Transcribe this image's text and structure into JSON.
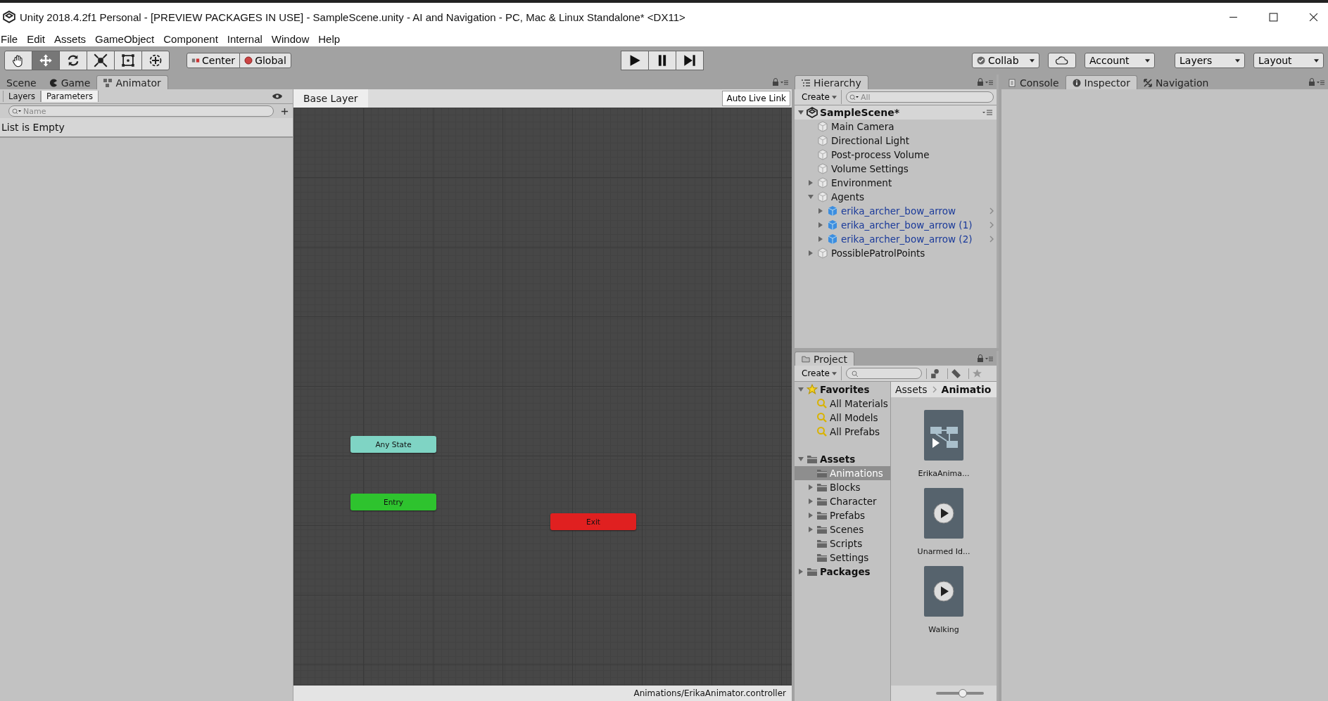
{
  "window": {
    "title": "Unity 2018.4.2f1 Personal - [PREVIEW PACKAGES IN USE] - SampleScene.unity - AI and Navigation - PC, Mac & Linux Standalone* <DX11>"
  },
  "menu": [
    "File",
    "Edit",
    "Assets",
    "GameObject",
    "Component",
    "Internal",
    "Window",
    "Help"
  ],
  "toolbar": {
    "tools": [
      {
        "kind": "hand",
        "selected": false
      },
      {
        "kind": "move",
        "selected": true
      },
      {
        "kind": "rotate",
        "selected": false
      },
      {
        "kind": "scale",
        "selected": false
      },
      {
        "kind": "rect",
        "selected": false
      },
      {
        "kind": "transform",
        "selected": false
      }
    ],
    "pivot": [
      {
        "label": "Center",
        "kind": "center"
      },
      {
        "label": "Global",
        "kind": "global"
      }
    ],
    "playback": [
      {
        "kind": "play"
      },
      {
        "kind": "pause"
      },
      {
        "kind": "step"
      }
    ],
    "right": [
      {
        "kind": "collab",
        "label": "Collab"
      },
      {
        "kind": "cloud"
      },
      {
        "kind": "dropdown",
        "label": "Account"
      },
      {
        "kind": "dropdown",
        "label": "Layers"
      },
      {
        "kind": "dropdown",
        "label": "Layout"
      }
    ]
  },
  "left_tabs": [
    {
      "label": "Scene",
      "kind": "scene",
      "selected": false
    },
    {
      "label": "Game",
      "kind": "game",
      "selected": false
    },
    {
      "label": "Animator",
      "kind": "animator",
      "selected": true
    }
  ],
  "animator": {
    "sub_tabs": [
      {
        "label": "Layers",
        "selected": false
      },
      {
        "label": "Parameters",
        "selected": true
      }
    ],
    "search": {
      "placeholder": "Name"
    },
    "empty_message": "List is Empty",
    "breadcrumb": "Base Layer",
    "auto_live_link": "Auto Live Link",
    "nodes": [
      {
        "label": "Any State",
        "kind": "any"
      },
      {
        "label": "Entry",
        "kind": "entry"
      },
      {
        "label": "Exit",
        "kind": "exit"
      }
    ],
    "status": "Animations/ErikaAnimator.controller"
  },
  "hierarchy": {
    "tab": "Hierarchy",
    "create": "Create",
    "search": {
      "placeholder": "All"
    },
    "scene": "SampleScene*",
    "items": [
      {
        "name": "Main Camera",
        "kind": "object"
      },
      {
        "name": "Directional Light",
        "kind": "object"
      },
      {
        "name": "Post-process Volume",
        "kind": "object"
      },
      {
        "name": "Volume Settings",
        "kind": "object"
      },
      {
        "name": "Environment",
        "kind": "object",
        "expanded": false
      },
      {
        "name": "Agents",
        "kind": "object",
        "expanded": true,
        "children": [
          {
            "name": "erika_archer_bow_arrow",
            "kind": "prefab",
            "expanded": false
          },
          {
            "name": "erika_archer_bow_arrow (1)",
            "kind": "prefab",
            "expanded": false
          },
          {
            "name": "erika_archer_bow_arrow (2)",
            "kind": "prefab",
            "expanded": false
          }
        ]
      },
      {
        "name": "PossiblePatrolPoints",
        "kind": "object",
        "expanded": false
      }
    ]
  },
  "project": {
    "tab": "Project",
    "create": "Create",
    "tree": [
      {
        "name": "Favorites",
        "kind": "favorites",
        "expanded": true,
        "selected": false,
        "children": [
          {
            "name": "All Materials",
            "kind": "search",
            "selected": false
          },
          {
            "name": "All Models",
            "kind": "search",
            "selected": false
          },
          {
            "name": "All Prefabs",
            "kind": "search",
            "selected": false
          }
        ]
      },
      {
        "name": "Assets",
        "kind": "root",
        "expanded": true,
        "selected": false,
        "children": [
          {
            "name": "Animations",
            "kind": "folder",
            "selected": true
          },
          {
            "name": "Blocks",
            "kind": "folder",
            "expanded": false,
            "selected": false
          },
          {
            "name": "Character",
            "kind": "folder",
            "expanded": false,
            "selected": false
          },
          {
            "name": "Prefabs",
            "kind": "folder",
            "expanded": false,
            "selected": false
          },
          {
            "name": "Scenes",
            "kind": "folder",
            "expanded": false,
            "selected": false
          },
          {
            "name": "Scripts",
            "kind": "folder",
            "selected": false
          },
          {
            "name": "Settings",
            "kind": "folder",
            "selected": false
          }
        ]
      },
      {
        "name": "Packages",
        "kind": "root",
        "expanded": false,
        "selected": false
      }
    ],
    "breadcrumb": [
      "Assets",
      "Animatio"
    ],
    "assets": [
      {
        "name": "ErikaAnima...",
        "kind": "controller"
      },
      {
        "name": "Unarmed Id...",
        "kind": "clip"
      },
      {
        "name": "Walking",
        "kind": "clip"
      }
    ],
    "zoom": {
      "level": 0.56
    }
  },
  "right_tabs": [
    {
      "label": "Console",
      "kind": "console",
      "selected": false
    },
    {
      "label": "Inspector",
      "kind": "inspector",
      "selected": true
    },
    {
      "label": "Navigation",
      "kind": "navigation",
      "selected": false
    }
  ]
}
